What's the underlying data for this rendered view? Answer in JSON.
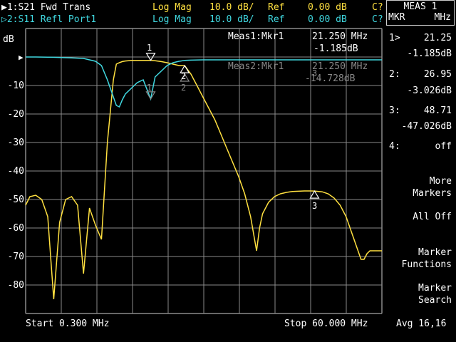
{
  "header": {
    "trace1": {
      "label": "▶1:S21 Fwd Trans",
      "format": "Log Mag",
      "scale": "10.0 dB/",
      "ref_label": "Ref",
      "ref_value": "0.00 dB",
      "cal": "C?"
    },
    "trace2": {
      "label": "▷2:S11 Refl Port1",
      "format": "Log Mag",
      "scale": "10.0 dB/",
      "ref_label": "Ref",
      "ref_value": "0.00 dB",
      "cal": "C?"
    }
  },
  "unit_label": "dB",
  "y_ticks": [
    "-10",
    "-20",
    "-30",
    "-40",
    "-50",
    "-60",
    "-70",
    "-80"
  ],
  "ref_arrow": "▶",
  "meas1": {
    "label": "Meas1:Mkr1",
    "freq": "21.250 MHz",
    "value": "-1.185dB"
  },
  "meas2": {
    "label": "Meas2:Mkr1",
    "freq": "21.250 MHz",
    "value": "-14.728dB"
  },
  "markers_on_trace": {
    "m1": "1",
    "m2": "2",
    "m3": "3",
    "m1b": "1",
    "m2b": "2",
    "m3b": "3"
  },
  "footer": {
    "start": "Start 0.300 MHz",
    "stop": "Stop 60.000 MHz",
    "avg": "Avg 16,16"
  },
  "softkeys": {
    "title": "MEAS 1",
    "sub_left": "MKR",
    "sub_right": "MHz",
    "markers": [
      {
        "num": "1>",
        "freq": "21.25",
        "value": "-1.185dB"
      },
      {
        "num": "2:",
        "freq": "26.95",
        "value": "-3.026dB"
      },
      {
        "num": "3:",
        "freq": "48.71",
        "value": "-47.026dB"
      },
      {
        "num": "4:",
        "freq": "off",
        "value": ""
      }
    ],
    "more_markers": "More\nMarkers",
    "all_off": "All Off",
    "marker_functions": "Marker\nFunctions",
    "marker_search": "Marker\nSearch"
  },
  "colors": {
    "trace1": "#ffe040",
    "trace2": "#40d8e0",
    "grid": "#8a8a8a"
  },
  "chart_data": {
    "type": "line",
    "xlim": [
      0.3,
      60.0
    ],
    "ylim": [
      -90,
      10
    ],
    "ylabel": "dB",
    "series": [
      {
        "name": "S21 Fwd Trans",
        "x": [
          0.3,
          1,
          2,
          3,
          4,
          5,
          6,
          7,
          8,
          9,
          10,
          11,
          12,
          13,
          14,
          15,
          15.5,
          16,
          16.5,
          17,
          17.5,
          18,
          18.5,
          19,
          19.5,
          20,
          21.25,
          22,
          23,
          24,
          25,
          26,
          26.95,
          28,
          29,
          30,
          31,
          32,
          33,
          34,
          35,
          36,
          37,
          38,
          38.5,
          39,
          39.5,
          40,
          41,
          42,
          43,
          44,
          45,
          46,
          47,
          48,
          48.71,
          50,
          51,
          52,
          53,
          54,
          55,
          56,
          56.5,
          57,
          57.5,
          58,
          59,
          60
        ],
        "y": [
          -52,
          -49,
          -48.5,
          -50,
          -56,
          -85,
          -58,
          -50,
          -49,
          -52,
          -76,
          -53,
          -59,
          -64,
          -30,
          -8,
          -2.5,
          -2,
          -1.6,
          -1.4,
          -1.3,
          -1.2,
          -1.2,
          -1.2,
          -1.2,
          -1.2,
          -1.185,
          -1.3,
          -1.6,
          -2,
          -2.5,
          -3,
          -3.026,
          -6,
          -10,
          -14,
          -18,
          -22,
          -27,
          -32,
          -37,
          -42,
          -48,
          -56,
          -62,
          -68,
          -60,
          -55,
          -51,
          -49,
          -48,
          -47.5,
          -47.2,
          -47.1,
          -47.0,
          -47.0,
          -47.026,
          -47.3,
          -48,
          -49.5,
          -52,
          -56,
          -62,
          -68,
          -71,
          -71,
          -69,
          -68,
          -68,
          -68
        ]
      },
      {
        "name": "S11 Refl Port1",
        "x": [
          0.3,
          2,
          5,
          8,
          10,
          12,
          13,
          14,
          15,
          15.5,
          16,
          16.5,
          17,
          18,
          19,
          20,
          21.25,
          22,
          23,
          24,
          25,
          26,
          27,
          28,
          30,
          35,
          40,
          45,
          50,
          55,
          60
        ],
        "y": [
          0,
          0,
          -0.1,
          -0.3,
          -0.5,
          -1.5,
          -3,
          -8,
          -14,
          -17,
          -17.5,
          -15,
          -13,
          -11,
          -9,
          -8,
          -14.728,
          -7,
          -5,
          -3,
          -2,
          -1.5,
          -1.2,
          -1.1,
          -1,
          -1,
          -1,
          -1,
          -1,
          -1,
          -1
        ]
      }
    ]
  }
}
